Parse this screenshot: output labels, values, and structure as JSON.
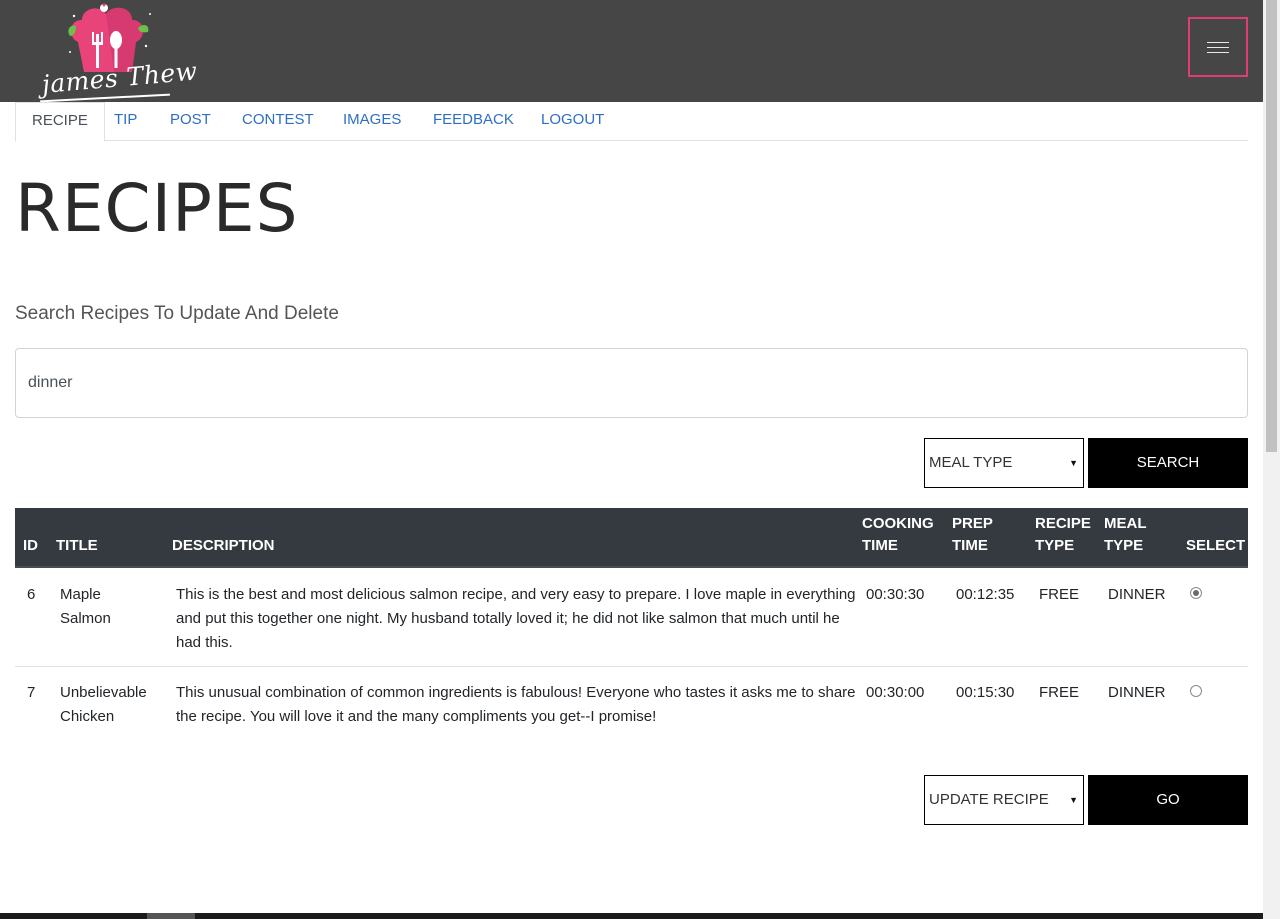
{
  "brand": {
    "logo_text": "james Thew"
  },
  "nav": {
    "menu_icon": "hamburger-icon",
    "tabs": [
      {
        "label": "RECIPE",
        "active": true
      },
      {
        "label": "TIP"
      },
      {
        "label": "POST"
      },
      {
        "label": "CONTEST"
      },
      {
        "label": "IMAGES"
      },
      {
        "label": "FEEDBACK"
      },
      {
        "label": "LOGOUT"
      }
    ]
  },
  "page": {
    "title": "RECIPES",
    "subtitle": "Search Recipes To Update And Delete"
  },
  "search": {
    "value": "dinner",
    "meal_type_selected": "MEAL TYPE",
    "search_label": "SEARCH"
  },
  "table": {
    "headers": {
      "id": "ID",
      "title": "TITLE",
      "description": "DESCRIPTION",
      "cooking_1": "COOKING",
      "cooking_2": "TIME",
      "prep_1": "PREP",
      "prep_2": "TIME",
      "recipe_1": "RECIPE",
      "recipe_2": "TYPE",
      "meal_1": "MEAL",
      "meal_2": "TYPE",
      "select": "SELECT"
    },
    "rows": [
      {
        "id": "6",
        "title_1": "Maple",
        "title_2": "Salmon",
        "description": "This is the best and most delicious salmon recipe, and very easy to prepare. I love maple in everything and put this together one night. My husband totally loved it; he did not like salmon that much until he had this.",
        "cooking_time": "00:30:30",
        "prep_time": "00:12:35",
        "recipe_type": "FREE",
        "meal_type": "DINNER",
        "selected": true
      },
      {
        "id": "7",
        "title_1": "Unbelievable",
        "title_2": "Chicken",
        "description": "This unusual combination of common ingredients is fabulous! Everyone who tastes it asks me to share the recipe. You will love it and the many compliments you get--I promise!",
        "cooking_time": "00:30:00",
        "prep_time": "00:15:30",
        "recipe_type": "FREE",
        "meal_type": "DINNER",
        "selected": false
      }
    ]
  },
  "actions": {
    "action_selected": "UPDATE RECIPE",
    "go_label": "GO"
  },
  "colors": {
    "header_bg": "#464646",
    "menu_border": "#e03e72",
    "link": "#2d6fc1",
    "table_head": "#343a40",
    "logo_pink": "#e8447a",
    "logo_leaf": "#6cc04a"
  }
}
